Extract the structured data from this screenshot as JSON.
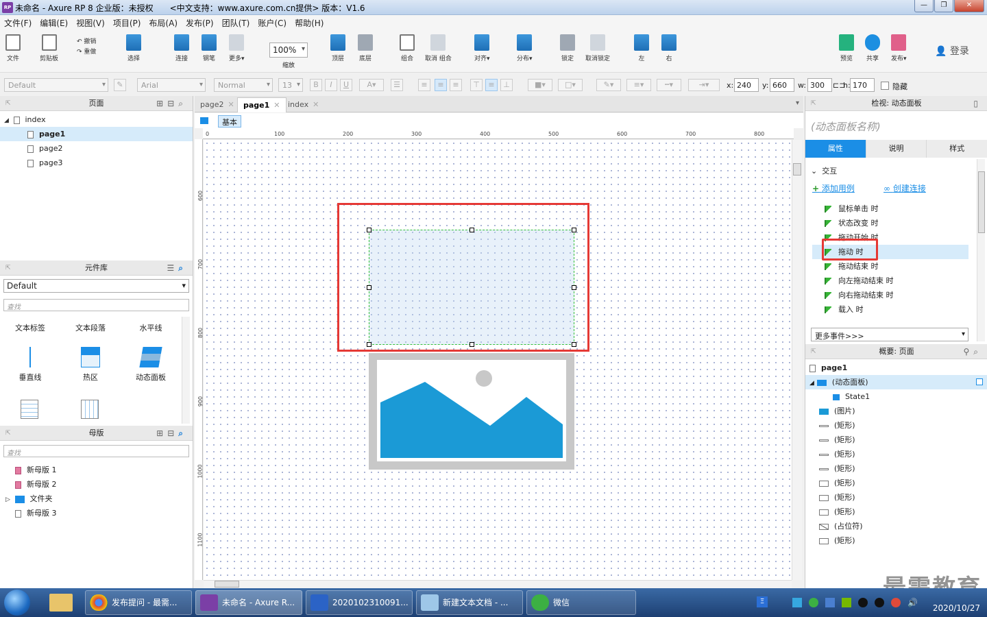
{
  "window": {
    "title": "未命名 - Axure RP 8 企业版：未授权　　<中文支持：www.axure.com.cn提供> 版本：V1.6",
    "app_icon": "RP"
  },
  "menu": [
    "文件(F)",
    "编辑(E)",
    "视图(V)",
    "项目(P)",
    "布局(A)",
    "发布(P)",
    "团队(T)",
    "账户(C)",
    "帮助(H)"
  ],
  "toolbar": {
    "file": "文件",
    "clipboard": "剪贴板",
    "undo": "撤销",
    "redo": "重做",
    "select": "选择",
    "connect": "连接",
    "pen": "钢笔",
    "more": "更多▾",
    "zoom": "100%",
    "zoom_label": "缩放",
    "top": "顶层",
    "bottom": "底层",
    "group": "组合",
    "ungroup": "取消 组合",
    "align": "对齐▾",
    "distribute": "分布▾",
    "lock": "锁定",
    "unlock": "取消锁定",
    "left": "左",
    "right": "右",
    "preview": "预览",
    "share": "共享",
    "publish": "发布▾",
    "login": "登录"
  },
  "formatbar": {
    "style": "Default",
    "font": "Arial",
    "weight": "Normal",
    "size": "13",
    "x_label": "x:",
    "x": "240",
    "y_label": "y:",
    "y": "660",
    "w_label": "w:",
    "w": "300",
    "h_label": "h:",
    "h": "170",
    "hide": "隐藏"
  },
  "pages_panel": {
    "title": "页面",
    "root": "index",
    "pages": [
      "page1",
      "page2",
      "page3"
    ]
  },
  "library_panel": {
    "title": "元件库",
    "library": "Default",
    "search_placeholder": "查找",
    "items_row1": [
      "文本标签",
      "文本段落",
      "水平线"
    ],
    "items_row2": [
      "垂直线",
      "热区",
      "动态面板"
    ]
  },
  "masters_panel": {
    "title": "母版",
    "search_placeholder": "查找",
    "items": [
      "新母版 1",
      "新母版 2",
      "文件夹",
      "新母版 3"
    ]
  },
  "tabs": [
    {
      "label": "page2"
    },
    {
      "label": "page1"
    },
    {
      "label": "index"
    }
  ],
  "state_tab": "基本",
  "ruler": {
    "h": [
      "0",
      "100",
      "200",
      "300",
      "400",
      "500",
      "600",
      "700",
      "800"
    ],
    "v": [
      "600",
      "700",
      "800",
      "900",
      "1000",
      "1100"
    ]
  },
  "inspector": {
    "title": "检视: 动态面板",
    "name_placeholder": "(动态面板名称)",
    "tabs": [
      "属性",
      "说明",
      "样式"
    ],
    "section": "交互",
    "add_case": "添加用例",
    "create_link": "创建连接",
    "events": [
      "鼠标单击 时",
      "状态改变 时",
      "拖动开始 时",
      "拖动 时",
      "拖动结束 时",
      "向左拖动结束 时",
      "向右拖动结束 时",
      "载入 时"
    ],
    "more_events": "更多事件>>>"
  },
  "outline": {
    "title": "概要: 页面",
    "page": "page1",
    "items": [
      "(动态面板)",
      "State1",
      "(图片)",
      "(矩形)",
      "(矩形)",
      "(矩形)",
      "(矩形)",
      "(矩形)",
      "(矩形)",
      "(矩形)",
      "(占位符)",
      "(矩形)"
    ]
  },
  "taskbar": {
    "items": [
      "发布提问 - 最需...",
      "未命名 - Axure R...",
      "2020102310091...",
      "新建文本文档 - ...",
      "微信"
    ],
    "date": "2020/10/27"
  },
  "watermark": "最需教育",
  "colors": {
    "accent": "#1b8ee6",
    "highlight_red": "#e53935",
    "image_blue": "#1b9ad6"
  }
}
